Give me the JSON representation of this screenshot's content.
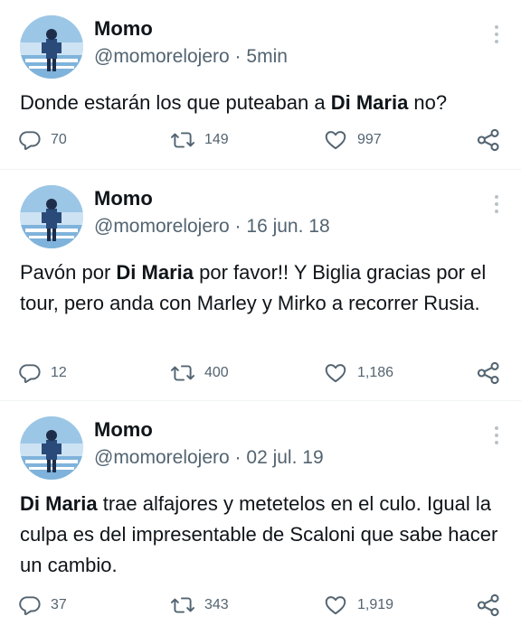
{
  "tweets": [
    {
      "name": "Momo",
      "handle": "@momorelojero",
      "separator": "·",
      "time": "5min",
      "text": [
        {
          "t": "Donde estarán los que puteaban a ",
          "b": false
        },
        {
          "t": "Di Maria",
          "b": true
        },
        {
          "t": " no?",
          "b": false
        }
      ],
      "replies": "70",
      "retweets": "149",
      "likes": "997"
    },
    {
      "name": "Momo",
      "handle": "@momorelojero",
      "separator": "·",
      "time": "16 jun. 18",
      "text": [
        {
          "t": "Pavón por ",
          "b": false
        },
        {
          "t": "Di Maria",
          "b": true
        },
        {
          "t": " por favor!! Y Biglia gracias por el tour, pero anda con Marley y Mirko a recorrer Rusia.",
          "b": false
        }
      ],
      "replies": "12",
      "retweets": "400",
      "likes": "1,186"
    },
    {
      "name": "Momo",
      "handle": "@momorelojero",
      "separator": "·",
      "time": "02 jul. 19",
      "text": [
        {
          "t": "Di Maria",
          "b": true
        },
        {
          "t": " trae alfajores y metetelos en el culo. Igual la culpa es del impresentable de Scaloni que sabe hacer un cambio.",
          "b": false
        }
      ],
      "replies": "37",
      "retweets": "343",
      "likes": "1,919"
    }
  ],
  "icons": {
    "reply": "reply-icon",
    "retweet": "retweet-icon",
    "like": "heart-icon",
    "share": "share-icon",
    "more": "more-options-icon"
  },
  "colors": {
    "text": "#0f1419",
    "secondary": "#536471",
    "divider": "#eff3f4"
  }
}
